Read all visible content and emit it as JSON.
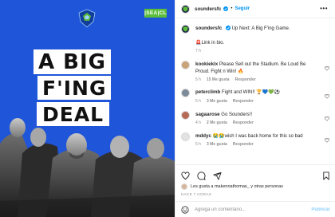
{
  "post": {
    "badge": "|SEA|CL",
    "headline": [
      "A BIG",
      "F'ING",
      "DEAL"
    ]
  },
  "header": {
    "username": "soundersfc",
    "separator": "•",
    "follow_label": "Seguir",
    "more_label": "•••"
  },
  "caption": {
    "username": "soundersfc",
    "line1": "Up Next: A Big F'ing Game.",
    "line2": "🚨Link in bio.",
    "time": "7 h"
  },
  "comments": [
    {
      "username": "kookiekix",
      "text": "Please Sell out the Stadium. Be Loud Be Proud. Fight n Win! 🔥",
      "time": "5 h",
      "likes": "15 Me gusta",
      "reply": "Responder"
    },
    {
      "username": "peterclimb",
      "text": "Fight and WIN!! 🏆💙💚⚽",
      "time": "5 h",
      "likes": "3 Me gusta",
      "reply": "Responder"
    },
    {
      "username": "sagaarose",
      "text": "Go Sounders!!",
      "time": "4 h",
      "likes": "2 Me gusta",
      "reply": "Responder"
    },
    {
      "username": "mddyc",
      "text": "😭😭wish I was back home for this so bad",
      "time": "5 h",
      "likes": "3 Me gusta",
      "reply": "Responder"
    }
  ],
  "actions": {
    "likes_text": "Les gusta a makennathomas_ y otras personas",
    "time_ago": "HACE 7 HORAS"
  },
  "add_comment": {
    "placeholder": "Agrega un comentario...",
    "publish_label": "Publicar"
  },
  "colors": {
    "post_background": "#1f55d9",
    "badge_green": "#5cbd3a",
    "link_blue": "#0095f6",
    "muted_text": "#8e8e8e"
  },
  "icons": [
    "verified-badge-icon",
    "more-options-icon",
    "heart-icon",
    "comment-icon",
    "share-icon",
    "bookmark-icon",
    "emoji-icon"
  ]
}
